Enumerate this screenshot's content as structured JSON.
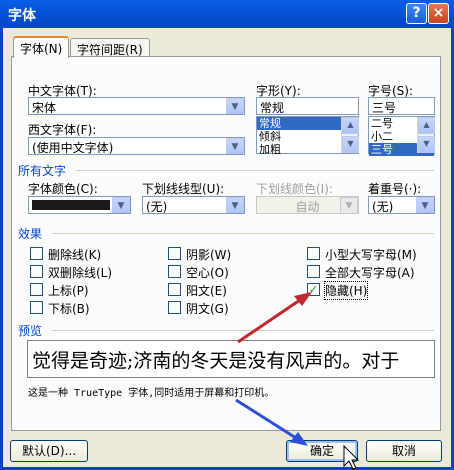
{
  "window": {
    "title": "字体",
    "help": "?",
    "close": "×"
  },
  "tabs": [
    {
      "label": "字体(N)"
    },
    {
      "label": "字符间距(R)"
    }
  ],
  "cn_font": {
    "label": "中文字体(T):",
    "value": "宋体"
  },
  "style": {
    "label": "字形(Y):",
    "value": "常规",
    "items": [
      "常规",
      "倾斜",
      "加粗"
    ],
    "selected": "常规"
  },
  "size": {
    "label": "字号(S):",
    "value": "三号",
    "items": [
      "二号",
      "小二",
      "三号"
    ],
    "selected": "三号"
  },
  "west_font": {
    "label": "西文字体(F):",
    "value": "(使用中文字体)"
  },
  "all_text": {
    "heading": "所有文字"
  },
  "font_color": {
    "label": "字体颜色(C):",
    "swatch": "#1a1a1a"
  },
  "underline_type": {
    "label": "下划线线型(U):",
    "value": "(无)"
  },
  "underline_color": {
    "label": "下划线颜色(I):",
    "value": "自动"
  },
  "emphasis": {
    "label": "着重号(·):",
    "value": "(无)"
  },
  "effects": {
    "heading": "效果",
    "items": [
      {
        "label": "删除线(K)",
        "checked": false
      },
      {
        "label": "阴影(W)",
        "checked": false
      },
      {
        "label": "小型大写字母(M)",
        "checked": false
      },
      {
        "label": "双删除线(L)",
        "checked": false
      },
      {
        "label": "空心(O)",
        "checked": false
      },
      {
        "label": "全部大写字母(A)",
        "checked": false
      },
      {
        "label": "上标(P)",
        "checked": false
      },
      {
        "label": "阳文(E)",
        "checked": false
      },
      {
        "label": "隐藏(H)",
        "checked": true
      },
      {
        "label": "下标(B)",
        "checked": false
      },
      {
        "label": "阴文(G)",
        "checked": false
      }
    ]
  },
  "preview": {
    "heading": "预览",
    "text": "觉得是奇迹;济南的冬天是没有风声的。对于",
    "note": "这是一种 TrueType 字体,同时适用于屏幕和打印机。"
  },
  "buttons": {
    "default": "默认(D)...",
    "ok": "确定",
    "cancel": "取消"
  },
  "colors": {
    "arrow": "#c0282c",
    "arrow_blue": "#2a4fd8",
    "title_bar": "#0454d6"
  }
}
